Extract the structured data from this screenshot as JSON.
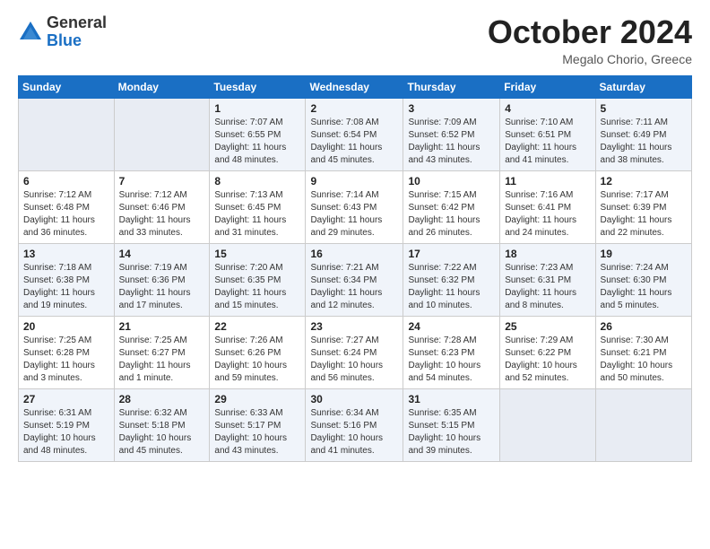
{
  "logo": {
    "general": "General",
    "blue": "Blue"
  },
  "header": {
    "month": "October 2024",
    "location": "Megalo Chorio, Greece"
  },
  "weekdays": [
    "Sunday",
    "Monday",
    "Tuesday",
    "Wednesday",
    "Thursday",
    "Friday",
    "Saturday"
  ],
  "weeks": [
    [
      {
        "day": "",
        "info": ""
      },
      {
        "day": "",
        "info": ""
      },
      {
        "day": "1",
        "info": "Sunrise: 7:07 AM\nSunset: 6:55 PM\nDaylight: 11 hours and 48 minutes."
      },
      {
        "day": "2",
        "info": "Sunrise: 7:08 AM\nSunset: 6:54 PM\nDaylight: 11 hours and 45 minutes."
      },
      {
        "day": "3",
        "info": "Sunrise: 7:09 AM\nSunset: 6:52 PM\nDaylight: 11 hours and 43 minutes."
      },
      {
        "day": "4",
        "info": "Sunrise: 7:10 AM\nSunset: 6:51 PM\nDaylight: 11 hours and 41 minutes."
      },
      {
        "day": "5",
        "info": "Sunrise: 7:11 AM\nSunset: 6:49 PM\nDaylight: 11 hours and 38 minutes."
      }
    ],
    [
      {
        "day": "6",
        "info": "Sunrise: 7:12 AM\nSunset: 6:48 PM\nDaylight: 11 hours and 36 minutes."
      },
      {
        "day": "7",
        "info": "Sunrise: 7:12 AM\nSunset: 6:46 PM\nDaylight: 11 hours and 33 minutes."
      },
      {
        "day": "8",
        "info": "Sunrise: 7:13 AM\nSunset: 6:45 PM\nDaylight: 11 hours and 31 minutes."
      },
      {
        "day": "9",
        "info": "Sunrise: 7:14 AM\nSunset: 6:43 PM\nDaylight: 11 hours and 29 minutes."
      },
      {
        "day": "10",
        "info": "Sunrise: 7:15 AM\nSunset: 6:42 PM\nDaylight: 11 hours and 26 minutes."
      },
      {
        "day": "11",
        "info": "Sunrise: 7:16 AM\nSunset: 6:41 PM\nDaylight: 11 hours and 24 minutes."
      },
      {
        "day": "12",
        "info": "Sunrise: 7:17 AM\nSunset: 6:39 PM\nDaylight: 11 hours and 22 minutes."
      }
    ],
    [
      {
        "day": "13",
        "info": "Sunrise: 7:18 AM\nSunset: 6:38 PM\nDaylight: 11 hours and 19 minutes."
      },
      {
        "day": "14",
        "info": "Sunrise: 7:19 AM\nSunset: 6:36 PM\nDaylight: 11 hours and 17 minutes."
      },
      {
        "day": "15",
        "info": "Sunrise: 7:20 AM\nSunset: 6:35 PM\nDaylight: 11 hours and 15 minutes."
      },
      {
        "day": "16",
        "info": "Sunrise: 7:21 AM\nSunset: 6:34 PM\nDaylight: 11 hours and 12 minutes."
      },
      {
        "day": "17",
        "info": "Sunrise: 7:22 AM\nSunset: 6:32 PM\nDaylight: 11 hours and 10 minutes."
      },
      {
        "day": "18",
        "info": "Sunrise: 7:23 AM\nSunset: 6:31 PM\nDaylight: 11 hours and 8 minutes."
      },
      {
        "day": "19",
        "info": "Sunrise: 7:24 AM\nSunset: 6:30 PM\nDaylight: 11 hours and 5 minutes."
      }
    ],
    [
      {
        "day": "20",
        "info": "Sunrise: 7:25 AM\nSunset: 6:28 PM\nDaylight: 11 hours and 3 minutes."
      },
      {
        "day": "21",
        "info": "Sunrise: 7:25 AM\nSunset: 6:27 PM\nDaylight: 11 hours and 1 minute."
      },
      {
        "day": "22",
        "info": "Sunrise: 7:26 AM\nSunset: 6:26 PM\nDaylight: 10 hours and 59 minutes."
      },
      {
        "day": "23",
        "info": "Sunrise: 7:27 AM\nSunset: 6:24 PM\nDaylight: 10 hours and 56 minutes."
      },
      {
        "day": "24",
        "info": "Sunrise: 7:28 AM\nSunset: 6:23 PM\nDaylight: 10 hours and 54 minutes."
      },
      {
        "day": "25",
        "info": "Sunrise: 7:29 AM\nSunset: 6:22 PM\nDaylight: 10 hours and 52 minutes."
      },
      {
        "day": "26",
        "info": "Sunrise: 7:30 AM\nSunset: 6:21 PM\nDaylight: 10 hours and 50 minutes."
      }
    ],
    [
      {
        "day": "27",
        "info": "Sunrise: 6:31 AM\nSunset: 5:19 PM\nDaylight: 10 hours and 48 minutes."
      },
      {
        "day": "28",
        "info": "Sunrise: 6:32 AM\nSunset: 5:18 PM\nDaylight: 10 hours and 45 minutes."
      },
      {
        "day": "29",
        "info": "Sunrise: 6:33 AM\nSunset: 5:17 PM\nDaylight: 10 hours and 43 minutes."
      },
      {
        "day": "30",
        "info": "Sunrise: 6:34 AM\nSunset: 5:16 PM\nDaylight: 10 hours and 41 minutes."
      },
      {
        "day": "31",
        "info": "Sunrise: 6:35 AM\nSunset: 5:15 PM\nDaylight: 10 hours and 39 minutes."
      },
      {
        "day": "",
        "info": ""
      },
      {
        "day": "",
        "info": ""
      }
    ]
  ]
}
